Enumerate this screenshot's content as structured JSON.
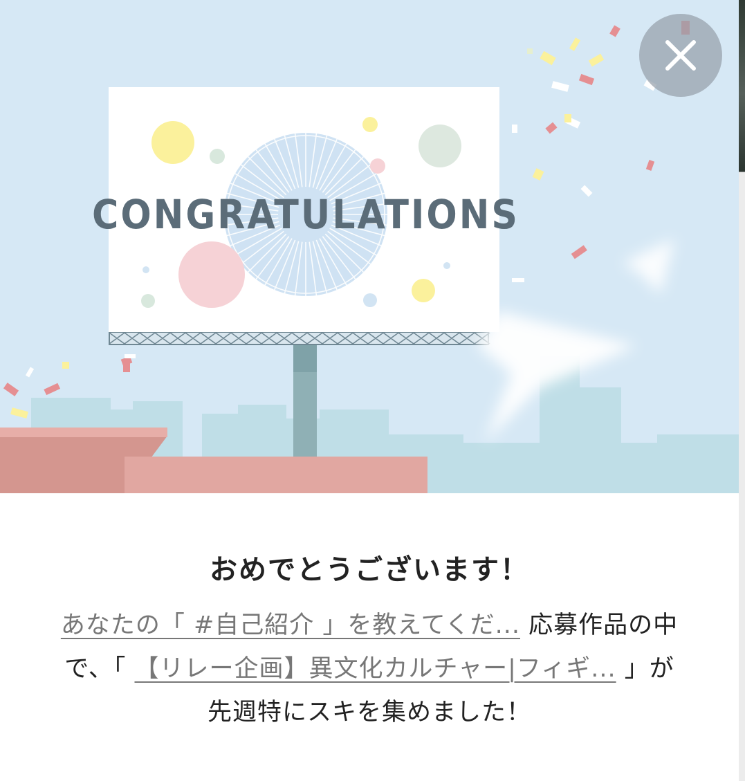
{
  "hero": {
    "billboard_text": "CONGRATULATIONS"
  },
  "close": {
    "icon": "close-icon"
  },
  "title": "おめでとうございます！",
  "message": {
    "hashtag_link": "あなたの「 #自己紹介 」を教えてくだ...",
    "text_after_hashtag": "応募作品の中で、「",
    "article_link": "【リレー企画】異文化カルチャー|フィギ...",
    "text_end": "」が先週特にスキを集めました！"
  },
  "colors": {
    "sky": "#d4e8f5",
    "billboard_text": "#5b6c78",
    "roof": "#e0a6a0",
    "buildings": "#bcdde6"
  }
}
